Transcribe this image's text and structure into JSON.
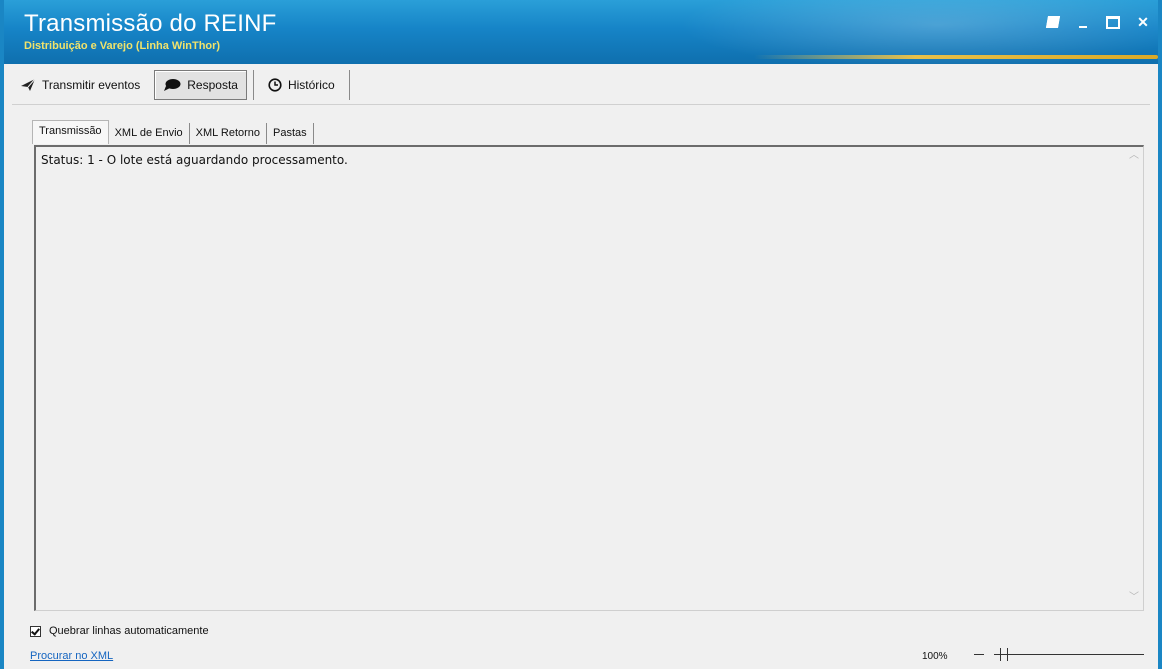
{
  "window": {
    "title": "Transmissão do REINF",
    "subtitle": "Distribuição e Varejo (Linha WinThor)"
  },
  "toolbar": {
    "buttons": [
      {
        "label": "Transmitir eventos",
        "icon": "send-icon"
      },
      {
        "label": "Resposta",
        "icon": "speech-bubble-icon",
        "active": true
      },
      {
        "label": "Histórico",
        "icon": "clock-icon"
      }
    ]
  },
  "tabs": [
    {
      "label": "Transmissão",
      "active": true
    },
    {
      "label": "XML de Envio"
    },
    {
      "label": "XML Retorno"
    },
    {
      "label": "Pastas"
    }
  ],
  "editor": {
    "text": "Status: 1 - O lote está aguardando processamento."
  },
  "options": {
    "wrap_label": "Quebrar linhas automaticamente",
    "wrap_checked": true
  },
  "footer": {
    "search_link": "Procurar no XML",
    "zoom": "100%"
  },
  "colors": {
    "titlebar": "#1684c7",
    "subtitle": "#f1e36b",
    "link": "#1565c0"
  }
}
